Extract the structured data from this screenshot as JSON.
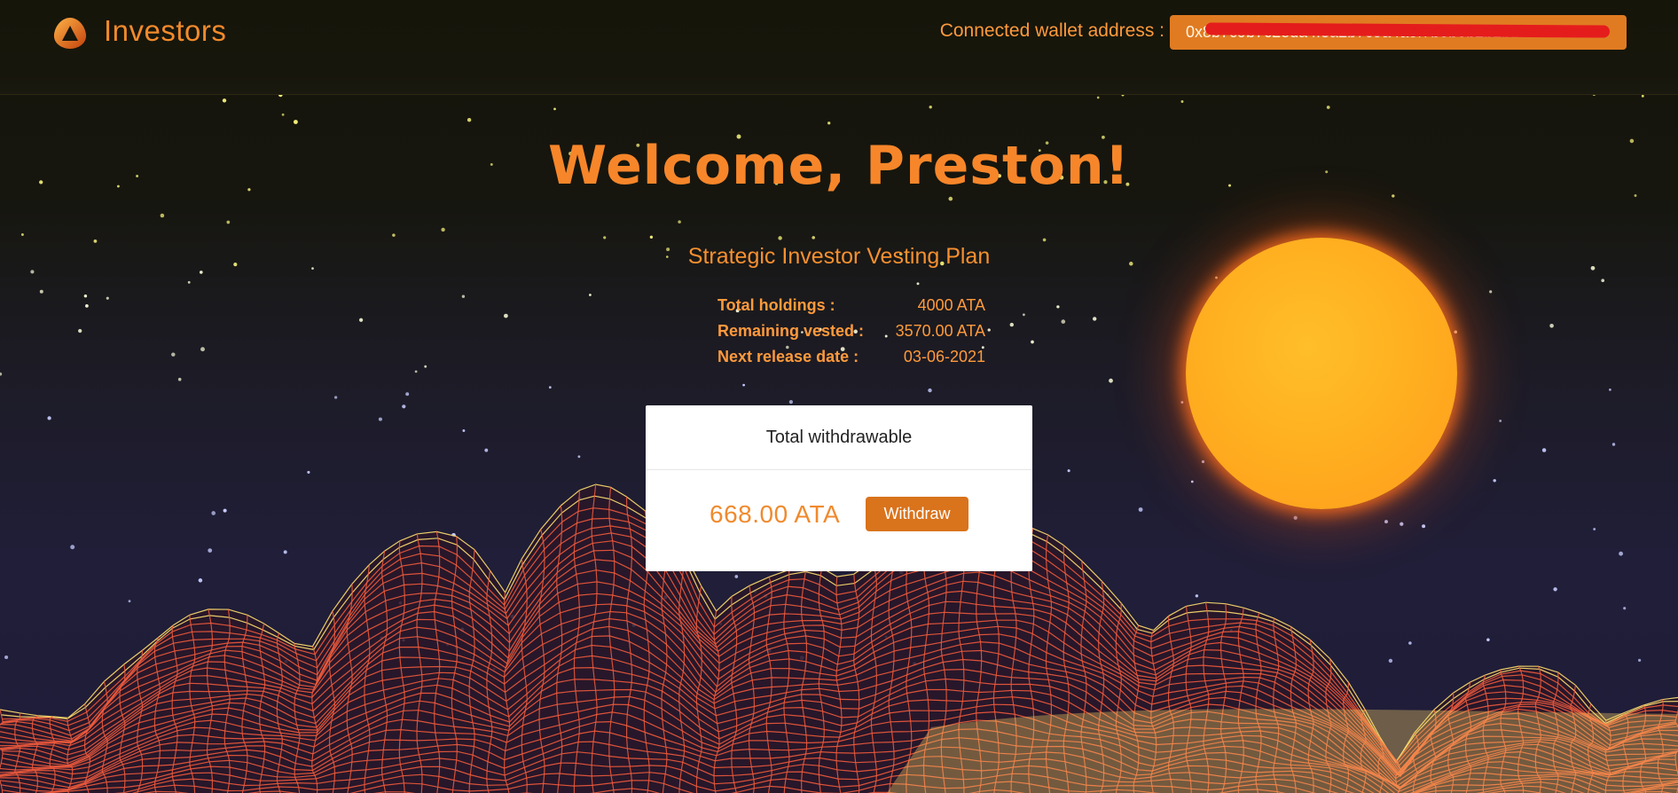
{
  "header": {
    "brand": "Investors",
    "wallet_label": "Connected wallet address :",
    "wallet_address": "0x8b7c9b7c2eda4f3a2b7c9a4a0f7b0b0b2b2b2b2b1c05"
  },
  "main": {
    "welcome": "Welcome, Preston!",
    "plan_title": "Strategic Investor Vesting Plan",
    "stats": [
      {
        "label": "Total holdings :",
        "value": "4000 ATA"
      },
      {
        "label": "Remaining vested :",
        "value": "3570.00 ATA"
      },
      {
        "label": "Next release date :",
        "value": "03-06-2021"
      }
    ],
    "card": {
      "title": "Total withdrawable",
      "amount": "668.00 ATA",
      "button_label": "Withdraw"
    }
  },
  "colors": {
    "accent": "#f7862a",
    "button": "#d9731c",
    "sun": "#ffb020",
    "terrain_line": "#f05a3c",
    "terrain_highlight": "#ffe070"
  }
}
